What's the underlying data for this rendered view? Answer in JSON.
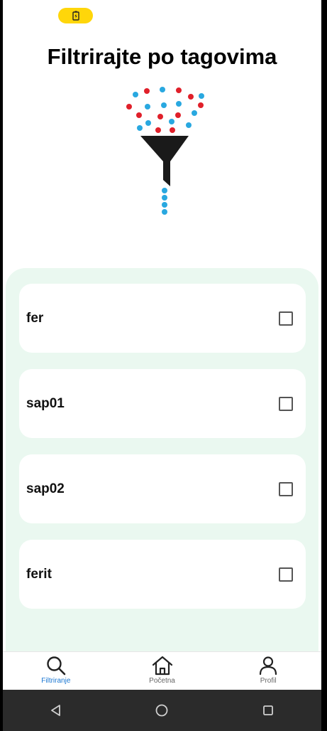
{
  "status_bar": {
    "battery_icon": "battery-charging-icon",
    "pill_color": "#ffd60a"
  },
  "page": {
    "title": "Filtrirajte po tagovima"
  },
  "illustration": {
    "icon": "funnel-filter-icon",
    "dot_colors": [
      "#e0202a",
      "#29a8e0"
    ]
  },
  "tags": [
    {
      "label": "fer",
      "checked": false
    },
    {
      "label": "sap01",
      "checked": false
    },
    {
      "label": "sap02",
      "checked": false
    },
    {
      "label": "ferit",
      "checked": false
    }
  ],
  "bottom_nav": {
    "items": [
      {
        "label": "Filtriranje",
        "icon": "search-icon",
        "active": true
      },
      {
        "label": "Početna",
        "icon": "home-icon",
        "active": false
      },
      {
        "label": "Profil",
        "icon": "user-icon",
        "active": false
      }
    ],
    "active_color": "#1976d2"
  },
  "system_nav": {
    "icons": [
      "back-icon",
      "home-circle-icon",
      "recents-icon"
    ]
  },
  "colors": {
    "panel_background": "#eaf8f0"
  }
}
